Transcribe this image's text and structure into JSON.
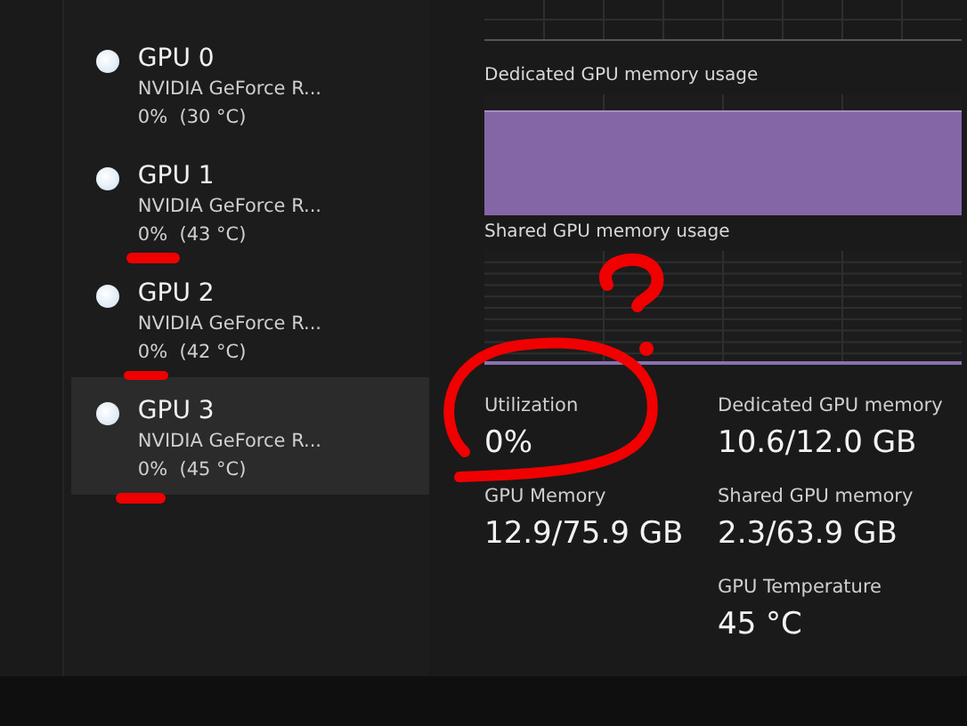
{
  "sidebar": {
    "items": [
      {
        "title": "GPU 0",
        "device": "NVIDIA GeForce R...",
        "status": "0%  (30 °C)",
        "selected": false
      },
      {
        "title": "GPU 1",
        "device": "NVIDIA GeForce R...",
        "status": "0%  (43 °C)",
        "selected": false
      },
      {
        "title": "GPU 2",
        "device": "NVIDIA GeForce R...",
        "status": "0%  (42 °C)",
        "selected": false
      },
      {
        "title": "GPU 3",
        "device": "NVIDIA GeForce R...",
        "status": "0%  (45 °C)",
        "selected": true
      }
    ]
  },
  "graphs": [
    {
      "title": "Dedicated GPU memory usage",
      "kind": "filled"
    },
    {
      "title": "Shared GPU memory usage",
      "kind": "empty"
    }
  ],
  "stats": [
    {
      "label": "Utilization",
      "value": "0%"
    },
    {
      "label": "Dedicated GPU memory",
      "value": "10.6/12.0 GB"
    },
    {
      "label": "GPU Memory",
      "value": "12.9/75.9 GB"
    },
    {
      "label": "Shared GPU memory",
      "value": "2.3/63.9 GB"
    },
    {
      "label": "GPU Temperature",
      "value": "45 °C"
    }
  ]
}
